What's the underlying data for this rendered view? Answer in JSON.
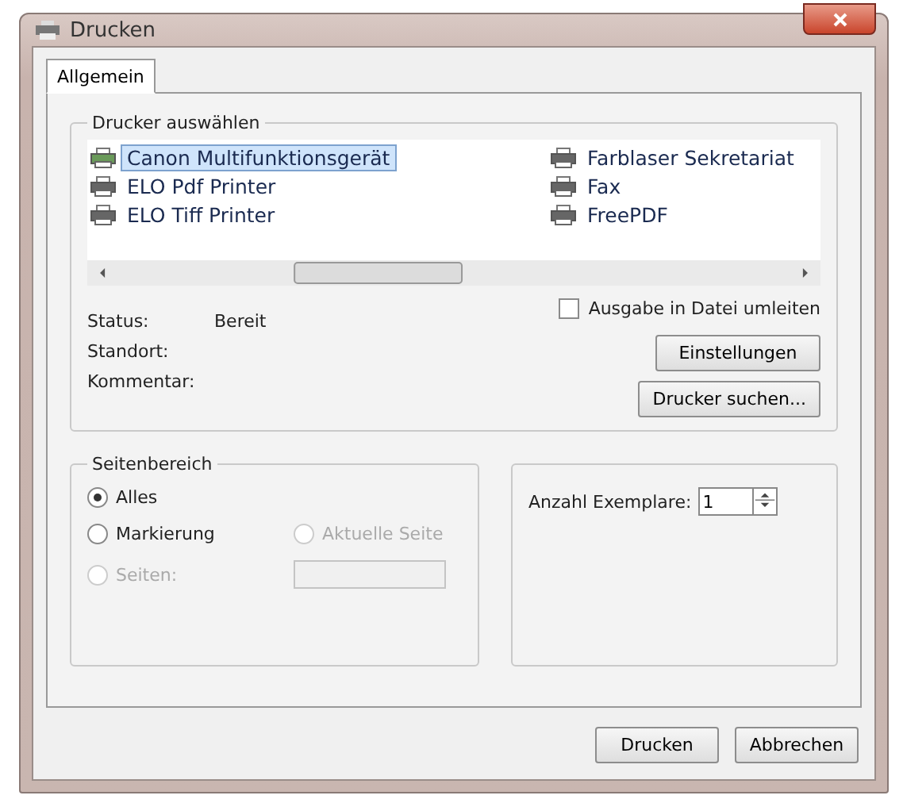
{
  "window": {
    "title": "Drucken"
  },
  "tabs": [
    {
      "label": "Allgemein",
      "selected": true
    }
  ],
  "printer_group": {
    "title": "Drucker auswählen",
    "printers": [
      {
        "name": "Canon Multifunktionsgerät",
        "selected": true
      },
      {
        "name": "ELO Pdf Printer",
        "selected": false
      },
      {
        "name": "ELO Tiff Printer",
        "selected": false
      },
      {
        "name": "Farblaser Sekretariat",
        "selected": false
      },
      {
        "name": "Fax",
        "selected": false
      },
      {
        "name": "FreePDF",
        "selected": false
      }
    ],
    "status": [
      {
        "label": "Status:",
        "value": "Bereit"
      },
      {
        "label": "Standort:"
      },
      {
        "label": "Kommentar:"
      }
    ],
    "print_to_file": {
      "label": "Ausgabe in Datei umleiten",
      "checked": false
    },
    "buttons": [
      "Einstellungen",
      "Drucker suchen..."
    ]
  },
  "page_range": {
    "title": "Seitenbereich",
    "options": [
      {
        "label": "Alles",
        "selected": true,
        "disabled": false
      },
      {
        "label": "Markierung",
        "selected": false,
        "disabled": false
      },
      {
        "label": "Aktuelle Seite",
        "selected": false,
        "disabled": true
      },
      {
        "label": "Seiten:",
        "selected": false,
        "disabled": true
      }
    ],
    "pages_field": {
      "disabled": true
    }
  },
  "copies": {
    "label": "Anzahl Exemplare:",
    "value": "1"
  },
  "buttons": [
    "Drucken",
    "Abbrechen"
  ]
}
